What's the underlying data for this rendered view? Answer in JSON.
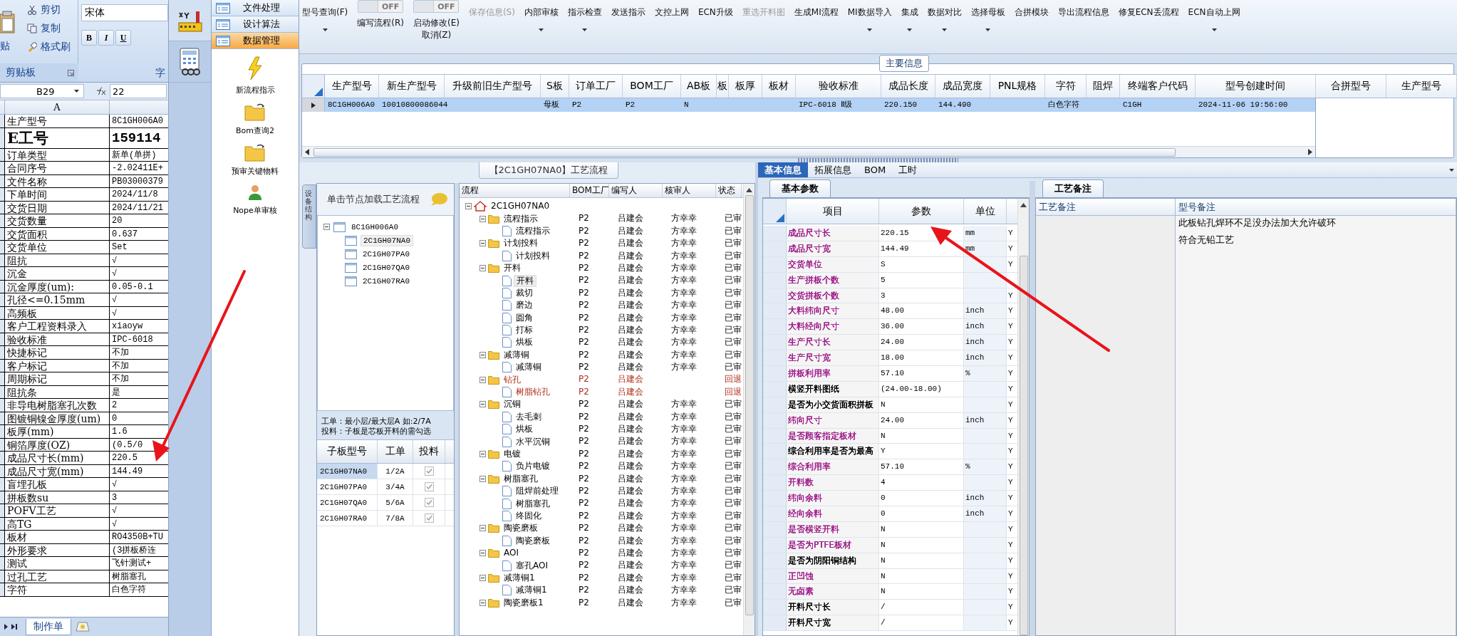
{
  "spreadsheet": {
    "ribbon": {
      "paste_label": "贴",
      "clipboard_buttons": [
        {
          "label": "剪切",
          "kind": "cut"
        },
        {
          "label": "复制",
          "kind": "copy"
        },
        {
          "label": "格式刷",
          "kind": "brush"
        }
      ],
      "clipboard_group": "剪贴板",
      "font_name": "宋体",
      "format_buttons": [
        "B",
        "I",
        "U"
      ],
      "font_group": "字"
    },
    "name_box": "B29",
    "formula": "22",
    "column_header": "A",
    "rows": [
      {
        "label": "生产型号",
        "value": "8C1GH006A0",
        "kind": "normal"
      },
      {
        "label": "E工号",
        "value": "159114",
        "kind": "big"
      },
      {
        "label": "订单类型",
        "value": "新单(单拼)",
        "kind": "normal"
      },
      {
        "label": "合同序号",
        "value": "-2.02411E+",
        "kind": "normal"
      },
      {
        "label": "文件名称",
        "value": "PB03000379",
        "kind": "normal"
      },
      {
        "label": "下单时间",
        "value": "2024/11/8",
        "kind": "normal"
      },
      {
        "label": "交货日期",
        "value": "2024/11/21",
        "kind": "normal"
      },
      {
        "label": "交货数量",
        "value": "20",
        "kind": "normal"
      },
      {
        "label": "交货面积",
        "value": "0.637",
        "kind": "normal"
      },
      {
        "label": "交货单位",
        "value": "Set",
        "kind": "normal"
      },
      {
        "label": "阻抗",
        "value": "√",
        "kind": "normal"
      },
      {
        "label": "沉金",
        "value": "√",
        "kind": "normal"
      },
      {
        "label": "沉金厚度(um):",
        "value": "0.05-0.1",
        "kind": "normal"
      },
      {
        "label": "孔径<=0.15mm",
        "value": "√",
        "kind": "normal"
      },
      {
        "label": "高频板",
        "value": "√",
        "kind": "normal"
      },
      {
        "label": "客户工程资料录入",
        "value": "xiaoyw",
        "kind": "normal"
      },
      {
        "label": "验收标准",
        "value": "IPC-6018",
        "kind": "normal"
      },
      {
        "label": "快捷标记",
        "value": "不加",
        "kind": "normal"
      },
      {
        "label": "客户标记",
        "value": "不加",
        "kind": "normal"
      },
      {
        "label": "周期标记",
        "value": "不加",
        "kind": "normal"
      },
      {
        "label": "阻抗条",
        "value": "是",
        "kind": "normal"
      },
      {
        "label": "非导电树脂塞孔次数",
        "value": "2",
        "kind": "normal"
      },
      {
        "label": "图镀铜镍金厚度(um)",
        "value": "0",
        "kind": "normal"
      },
      {
        "label": "板厚(mm)",
        "value": "1.6",
        "kind": "normal"
      },
      {
        "label": "铜箔厚度(OZ)",
        "value": "(0.5/0",
        "kind": "normal"
      },
      {
        "label": "成品尺寸长(mm)",
        "value": "220.5",
        "kind": "normal"
      },
      {
        "label": "成品尺寸宽(mm)",
        "value": "144.49",
        "kind": "normal"
      },
      {
        "label": "盲埋孔板",
        "value": "√",
        "kind": "normal"
      },
      {
        "label": "拼板数su",
        "value": "3",
        "kind": "normal"
      },
      {
        "label": "POFV工艺",
        "value": "√",
        "kind": "normal"
      },
      {
        "label": "高TG",
        "value": "√",
        "kind": "normal"
      },
      {
        "label": "板材",
        "value": "RO4350B+TU",
        "kind": "normal"
      },
      {
        "label": "外形要求",
        "value": "(3拼板桥连",
        "kind": "normal"
      },
      {
        "label": "测试",
        "value": "飞针测试+",
        "kind": "normal"
      },
      {
        "label": "过孔工艺",
        "value": "树脂塞孔",
        "kind": "normal"
      },
      {
        "label": "字符",
        "value": "白色字符",
        "kind": "normal"
      }
    ],
    "sheet_tab": "制作单"
  },
  "app_nav": {
    "modules": [
      {
        "kind": "factory",
        "selected": true
      },
      {
        "kind": "calculator",
        "selected": false
      }
    ],
    "sections": [
      {
        "label": "文件处理",
        "selected": false
      },
      {
        "label": "设计算法",
        "selected": false
      },
      {
        "label": "数据管理",
        "selected": true
      }
    ],
    "items": [
      {
        "label": "新流程指示",
        "kind": "lightning"
      },
      {
        "label": "Bom查询2",
        "kind": "folder"
      },
      {
        "label": "预审关键物料",
        "kind": "folder"
      },
      {
        "label": "Nope单审核",
        "kind": "person"
      }
    ]
  },
  "toolbar": {
    "buttons": [
      {
        "label": "型号查询(F)",
        "kind": "dropdown",
        "disabled": false
      },
      {
        "label": "编写流程(R)",
        "kind": "toggle",
        "on": false,
        "state_text": "OFF",
        "disabled": false
      },
      {
        "label": "启动修改(E)",
        "second_line": "取消(Z)",
        "kind": "toggle",
        "on": false,
        "state_text": "OFF",
        "disabled": false
      },
      {
        "label": "保存信息(S)",
        "kind": "button",
        "disabled": true
      },
      {
        "label": "内部审核",
        "kind": "dropdown",
        "disabled": false
      },
      {
        "label": "指示检查",
        "kind": "dropdown",
        "disabled": false
      },
      {
        "label": "发送指示",
        "kind": "button",
        "disabled": false
      },
      {
        "label": "文控上网",
        "kind": "button",
        "disabled": false
      },
      {
        "label": "ECN升级",
        "kind": "button",
        "disabled": false
      },
      {
        "label": "重选开料图",
        "kind": "button",
        "disabled": true
      },
      {
        "label": "生成MI流程",
        "kind": "button",
        "disabled": false
      },
      {
        "label": "MI数据导入",
        "kind": "dropdown",
        "disabled": false
      },
      {
        "label": "集成",
        "kind": "dropdown",
        "disabled": false
      },
      {
        "label": "数据对比",
        "kind": "dropdown",
        "disabled": false
      },
      {
        "label": "选择母板",
        "kind": "dropdown",
        "disabled": false
      },
      {
        "label": "合拼模块",
        "kind": "button",
        "disabled": false
      },
      {
        "label": "导出流程信息",
        "kind": "button",
        "disabled": false
      },
      {
        "label": "修复ECN丢流程",
        "kind": "button",
        "disabled": false
      },
      {
        "label": "ECN自动上网",
        "kind": "dropdown",
        "disabled": false
      }
    ]
  },
  "main_info": {
    "group_title": "主要信息",
    "columns": [
      "生产型号",
      "新生产型号",
      "升级前旧生产型号",
      "S板",
      "订单工厂",
      "BOM工厂",
      "AB板",
      "板",
      "板厚",
      "板材",
      "验收标准",
      "成品长度",
      "成品宽度",
      "PNL规格",
      "字符",
      "阻焊",
      "终端客户代码",
      "型号创建时间"
    ],
    "rows": [
      {
        "selected": true,
        "cells": [
          "8C1GH006A0",
          "10010800086044",
          "",
          "母板",
          "P2",
          "P2",
          "N",
          "",
          "",
          "",
          "IPC-6018 Ⅱ级",
          "220.150",
          "144.490",
          "",
          "白色字符",
          "",
          "C1GH",
          "2024-11-06 19:56:00"
        ]
      }
    ],
    "side_columns": [
      "合拼型号",
      "生产型号"
    ]
  },
  "process": {
    "title": "【2C1GH07NA0】工艺流程",
    "side_tab": "设备结构",
    "tree_header": "单击节点加载工艺流程",
    "board_tree": {
      "label": "8C1GH006A0",
      "expanded": true,
      "selected": false,
      "children": [
        {
          "label": "2C1GH07NA0",
          "selected": true
        },
        {
          "label": "2C1GH07PA0",
          "selected": false
        },
        {
          "label": "2C1GH07QA0",
          "selected": false
        },
        {
          "label": "2C1GH07RA0",
          "selected": false
        }
      ]
    },
    "notes": [
      "工单：最小层/最大层A 如:2/7A",
      "投料：子板是芯板开料的需勾选"
    ],
    "sub_boards": {
      "columns": [
        "子板型号",
        "工单",
        "投料"
      ],
      "rows": [
        {
          "model": "2C1GH07NA0",
          "order": "1/2A",
          "checked": true,
          "selected": true
        },
        {
          "model": "2C1GH07PA0",
          "order": "3/4A",
          "checked": true,
          "selected": false
        },
        {
          "model": "2C1GH07QA0",
          "order": "5/6A",
          "checked": true,
          "selected": false
        },
        {
          "model": "2C1GH07RA0",
          "order": "7/8A",
          "checked": true,
          "selected": false
        }
      ]
    },
    "flow": {
      "columns": [
        "流程",
        "BOM工厂",
        "编写人",
        "核审人",
        "状态"
      ],
      "root": {
        "label": "2C1GH07NA0",
        "expanded": true,
        "children": [
          {
            "label": "流程指示",
            "factory": "P2",
            "writer": "吕建会",
            "reviewer": "方幸幸",
            "status": "已审",
            "returned": false,
            "selected": false,
            "expanded": true,
            "children": [
              {
                "label": "流程指示",
                "factory": "P2",
                "writer": "吕建会",
                "reviewer": "方幸幸",
                "status": "已审",
                "returned": false,
                "selected": false
              }
            ]
          },
          {
            "label": "计划投料",
            "factory": "P2",
            "writer": "吕建会",
            "reviewer": "方幸幸",
            "status": "已审",
            "returned": false,
            "selected": false,
            "expanded": true,
            "children": [
              {
                "label": "计划投料",
                "factory": "P2",
                "writer": "吕建会",
                "reviewer": "方幸幸",
                "status": "已审",
                "returned": false,
                "selected": false
              }
            ]
          },
          {
            "label": "开料",
            "factory": "P2",
            "writer": "吕建会",
            "reviewer": "方幸幸",
            "status": "已审",
            "returned": false,
            "selected": false,
            "expanded": true,
            "children": [
              {
                "label": "开料",
                "factory": "P2",
                "writer": "吕建会",
                "reviewer": "方幸幸",
                "status": "已审",
                "returned": false,
                "selected": true
              },
              {
                "label": "裁切",
                "factory": "P2",
                "writer": "吕建会",
                "reviewer": "方幸幸",
                "status": "已审",
                "returned": false,
                "selected": false
              },
              {
                "label": "磨边",
                "factory": "P2",
                "writer": "吕建会",
                "reviewer": "方幸幸",
                "status": "已审",
                "returned": false,
                "selected": false
              },
              {
                "label": "圆角",
                "factory": "P2",
                "writer": "吕建会",
                "reviewer": "方幸幸",
                "status": "已审",
                "returned": false,
                "selected": false
              },
              {
                "label": "打标",
                "factory": "P2",
                "writer": "吕建会",
                "reviewer": "方幸幸",
                "status": "已审",
                "returned": false,
                "selected": false
              },
              {
                "label": "烘板",
                "factory": "P2",
                "writer": "吕建会",
                "reviewer": "方幸幸",
                "status": "已审",
                "returned": false,
                "selected": false
              }
            ]
          },
          {
            "label": "减薄铜",
            "factory": "P2",
            "writer": "吕建会",
            "reviewer": "方幸幸",
            "status": "已审",
            "returned": false,
            "selected": false,
            "expanded": true,
            "children": [
              {
                "label": "减薄铜",
                "factory": "P2",
                "writer": "吕建会",
                "reviewer": "方幸幸",
                "status": "已审",
                "returned": false,
                "selected": false
              }
            ]
          },
          {
            "label": "钻孔",
            "factory": "P2",
            "writer": "吕建会",
            "status": "回退",
            "returned": true,
            "selected": false,
            "expanded": true,
            "children": [
              {
                "label": "树脂钻孔",
                "factory": "P2",
                "writer": "吕建会",
                "status": "回退",
                "returned": true,
                "selected": false
              }
            ]
          },
          {
            "label": "沉铜",
            "factory": "P2",
            "writer": "吕建会",
            "reviewer": "方幸幸",
            "status": "已审",
            "returned": false,
            "selected": false,
            "expanded": true,
            "children": [
              {
                "label": "去毛刺",
                "factory": "P2",
                "writer": "吕建会",
                "reviewer": "方幸幸",
                "status": "已审",
                "returned": false,
                "selected": false
              },
              {
                "label": "烘板",
                "factory": "P2",
                "writer": "吕建会",
                "reviewer": "方幸幸",
                "status": "已审",
                "returned": false,
                "selected": false
              },
              {
                "label": "水平沉铜",
                "factory": "P2",
                "writer": "吕建会",
                "reviewer": "方幸幸",
                "status": "已审",
                "returned": false,
                "selected": false
              }
            ]
          },
          {
            "label": "电镀",
            "factory": "P2",
            "writer": "吕建会",
            "reviewer": "方幸幸",
            "status": "已审",
            "returned": false,
            "selected": false,
            "expanded": true,
            "children": [
              {
                "label": "负片电镀",
                "factory": "P2",
                "writer": "吕建会",
                "reviewer": "方幸幸",
                "status": "已审",
                "returned": false,
                "selected": false
              }
            ]
          },
          {
            "label": "树脂塞孔",
            "factory": "P2",
            "writer": "吕建会",
            "reviewer": "方幸幸",
            "status": "已审",
            "returned": false,
            "selected": false,
            "expanded": true,
            "children": [
              {
                "label": "阻焊前处理",
                "factory": "P2",
                "writer": "吕建会",
                "reviewer": "方幸幸",
                "status": "已审",
                "returned": false,
                "selected": false
              },
              {
                "label": "树脂塞孔",
                "factory": "P2",
                "writer": "吕建会",
                "reviewer": "方幸幸",
                "status": "已审",
                "returned": false,
                "selected": false
              },
              {
                "label": "终固化",
                "factory": "P2",
                "writer": "吕建会",
                "reviewer": "方幸幸",
                "status": "已审",
                "returned": false,
                "selected": false
              }
            ]
          },
          {
            "label": "陶瓷磨板",
            "factory": "P2",
            "writer": "吕建会",
            "reviewer": "方幸幸",
            "status": "已审",
            "returned": false,
            "selected": false,
            "expanded": true,
            "children": [
              {
                "label": "陶瓷磨板",
                "factory": "P2",
                "writer": "吕建会",
                "reviewer": "方幸幸",
                "status": "已审",
                "returned": false,
                "selected": false
              }
            ]
          },
          {
            "label": "AOI",
            "factory": "P2",
            "writer": "吕建会",
            "reviewer": "方幸幸",
            "status": "已审",
            "returned": false,
            "selected": false,
            "expanded": true,
            "children": [
              {
                "label": "塞孔AOI",
                "factory": "P2",
                "writer": "吕建会",
                "reviewer": "方幸幸",
                "status": "已审",
                "returned": false,
                "selected": false
              }
            ]
          },
          {
            "label": "减薄铜1",
            "factory": "P2",
            "writer": "吕建会",
            "reviewer": "方幸幸",
            "status": "已审",
            "returned": false,
            "selected": false,
            "expanded": true,
            "children": [
              {
                "label": "减薄铜1",
                "factory": "P2",
                "writer": "吕建会",
                "reviewer": "方幸幸",
                "status": "已审",
                "returned": false,
                "selected": false
              }
            ]
          },
          {
            "label": "陶瓷磨板1",
            "factory": "P2",
            "writer": "吕建会",
            "reviewer": "方幸幸",
            "status": "已审",
            "returned": false,
            "selected": false,
            "expanded": true
          }
        ]
      }
    }
  },
  "details": {
    "tabs": [
      {
        "label": "基本信息",
        "selected": true
      },
      {
        "label": "拓展信息",
        "selected": false
      },
      {
        "label": "BOM",
        "selected": false
      },
      {
        "label": "工时",
        "selected": false
      }
    ],
    "params": {
      "tab": "基本参数",
      "columns": [
        "项目",
        "参数",
        "单位"
      ],
      "rows": [
        {
          "name": "成品尺寸长",
          "value": "220.15",
          "unit": "mm",
          "flag": "Y",
          "color": "#a0208c"
        },
        {
          "name": "成品尺寸宽",
          "value": "144.49",
          "unit": "mm",
          "flag": "Y",
          "color": "#a0208c"
        },
        {
          "name": "交货单位",
          "value": "S",
          "unit": "",
          "flag": "Y",
          "color": "#a0208c"
        },
        {
          "name": "生产拼板个数",
          "value": "5",
          "unit": "",
          "color": "#a0208c"
        },
        {
          "name": "交货拼板个数",
          "value": "3",
          "unit": "",
          "flag": "Y",
          "color": "#a0208c"
        },
        {
          "name": "大料纬向尺寸",
          "value": "48.00",
          "unit": "inch",
          "flag": "Y",
          "color": "#a0208c"
        },
        {
          "name": "大料经向尺寸",
          "value": "36.00",
          "unit": "inch",
          "flag": "Y",
          "color": "#a0208c"
        },
        {
          "name": "生产尺寸长",
          "value": "24.00",
          "unit": "inch",
          "flag": "Y",
          "color": "#a0208c"
        },
        {
          "name": "生产尺寸宽",
          "value": "18.00",
          "unit": "inch",
          "flag": "Y",
          "color": "#a0208c"
        },
        {
          "name": "拼板利用率",
          "value": "57.10",
          "unit": "%",
          "flag": "Y",
          "color": "#a0208c"
        },
        {
          "name": "横竖开料图纸",
          "value": "(24.00-18.00)",
          "unit": "",
          "flag": "Y",
          "color": "#000000"
        },
        {
          "name": "是否为小交货面积拼板",
          "value": "N",
          "unit": "",
          "flag": "Y",
          "color": "#000000"
        },
        {
          "name": "纬向尺寸",
          "value": "24.00",
          "unit": "inch",
          "flag": "Y",
          "color": "#a0208c"
        },
        {
          "name": "是否顾客指定板材",
          "value": "N",
          "unit": "",
          "flag": "Y",
          "color": "#a0208c"
        },
        {
          "name": "综合利用率是否为最高",
          "value": "Y",
          "unit": "",
          "flag": "Y",
          "color": "#000000"
        },
        {
          "name": "综合利用率",
          "value": "57.10",
          "unit": "%",
          "flag": "Y",
          "color": "#a0208c"
        },
        {
          "name": "开料数",
          "value": "4",
          "unit": "",
          "flag": "Y",
          "color": "#a0208c"
        },
        {
          "name": "纬向余料",
          "value": "0",
          "unit": "inch",
          "flag": "Y",
          "color": "#a0208c"
        },
        {
          "name": "经向余料",
          "value": "0",
          "unit": "inch",
          "flag": "Y",
          "color": "#a0208c"
        },
        {
          "name": "是否横竖开料",
          "value": "N",
          "unit": "",
          "flag": "Y",
          "color": "#a0208c"
        },
        {
          "name": "是否为PTFE板材",
          "value": "N",
          "unit": "",
          "flag": "Y",
          "color": "#a0208c"
        },
        {
          "name": "是否为阴阳铜结构",
          "value": "N",
          "unit": "",
          "flag": "Y",
          "color": "#000000"
        },
        {
          "name": "正凹蚀",
          "value": "N",
          "unit": "",
          "flag": "Y",
          "color": "#a0208c"
        },
        {
          "name": "无卤素",
          "value": "N",
          "unit": "",
          "flag": "Y",
          "color": "#a0208c"
        },
        {
          "name": "开料尺寸长",
          "value": "/",
          "unit": "",
          "flag": "Y",
          "color": "#000000"
        },
        {
          "name": "开料尺寸宽",
          "value": "/",
          "unit": "",
          "flag": "Y",
          "color": "#000000"
        }
      ]
    },
    "remarks": {
      "tab": "工艺备注",
      "columns": [
        "工艺备注",
        "型号备注"
      ],
      "model_notes": [
        "此板钻孔焊环不足没办法加大允许破环",
        "符合无铅工艺"
      ]
    }
  }
}
